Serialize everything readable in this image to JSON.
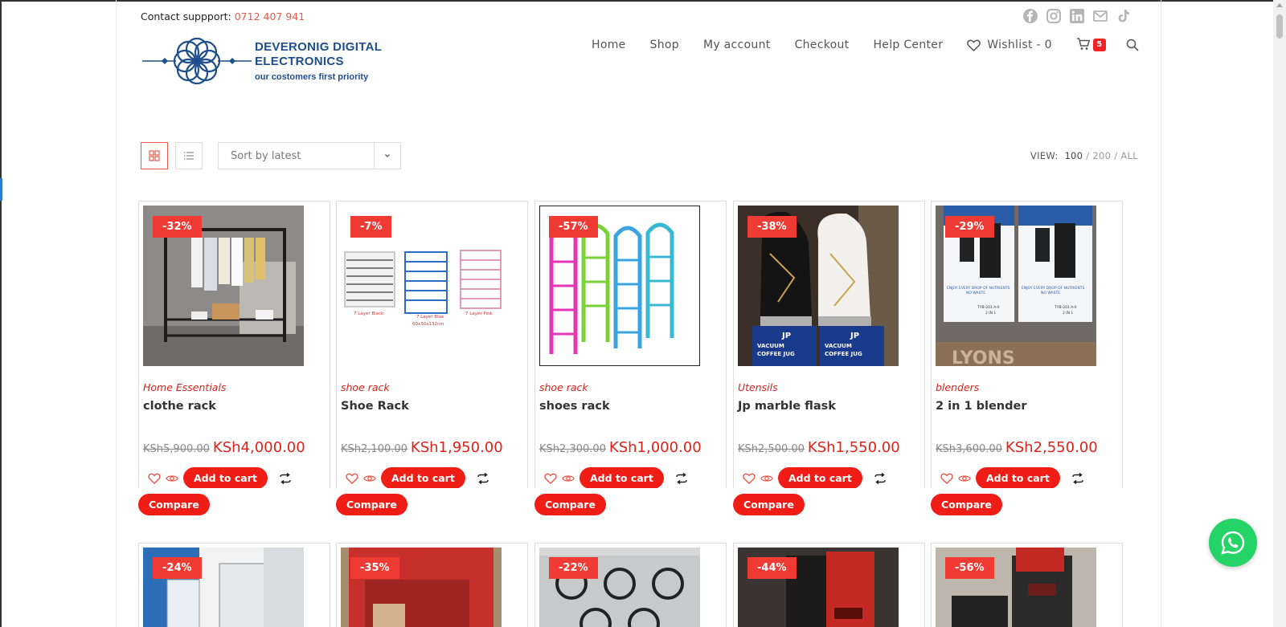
{
  "contact": {
    "label": "Contact suppport: ",
    "phone": "0712 407 941"
  },
  "social_icons": [
    "facebook-icon",
    "instagram-icon",
    "linkedin-icon",
    "email-icon",
    "tiktok-icon"
  ],
  "logo": {
    "line1": "DEVERONIG DIGITAL",
    "line2": "ELECTRONICS",
    "tagline": "our costomers first priority"
  },
  "nav": {
    "items": [
      "Home",
      "Shop",
      "My account",
      "Checkout",
      "Help Center"
    ],
    "wishlist": "Wishlist - 0",
    "cart_count": "5"
  },
  "toolbar": {
    "sort_label": "Sort by latest",
    "view_label": "VIEW:",
    "view_options": [
      "100",
      "200",
      "ALL"
    ],
    "view_sep": "/"
  },
  "products": [
    {
      "discount": "-32%",
      "category": "Home Essentials",
      "name": "clothe rack",
      "old_price": "KSh5,900.00",
      "price": "KSh4,000.00"
    },
    {
      "discount": "-7%",
      "category": "shoe rack",
      "name": "Shoe Rack",
      "old_price": "KSh2,100.00",
      "price": "KSh1,950.00"
    },
    {
      "discount": "-57%",
      "category": "shoe rack",
      "name": "shoes rack",
      "old_price": "KSh2,300.00",
      "price": "KSh1,000.00"
    },
    {
      "discount": "-38%",
      "category": "Utensils",
      "name": "Jp marble flask",
      "old_price": "KSh2,500.00",
      "price": "KSh1,550.00"
    },
    {
      "discount": "-29%",
      "category": "blenders",
      "name": "2 in 1 blender",
      "old_price": "KSh3,600.00",
      "price": "KSh2,550.00"
    }
  ],
  "products_row2": [
    {
      "discount": "-24%"
    },
    {
      "discount": "-35%"
    },
    {
      "discount": "-22%"
    },
    {
      "discount": "-44%"
    },
    {
      "discount": "-56%"
    }
  ],
  "buttons": {
    "add_to_cart": "Add to cart",
    "compare": "Compare"
  },
  "image_text": {
    "shoe_rack_labels": [
      "7 Layer Black",
      "7 Layer Blue",
      "60x30x132cm",
      "7 Layer Pink"
    ],
    "flask_label": [
      "VACUUM",
      "COFFEE JUG"
    ],
    "flask_brand": "JP",
    "blender_brand": "LYONS",
    "blender_box_text": [
      "ENJOY EVERY DROP OF NUTRIENTS",
      "NO WASTE"
    ],
    "blender_model": [
      "TYB-201-A-II",
      "2 IN 1"
    ]
  },
  "colors": {
    "accent": "#f01d16",
    "brand": "#1f4e8c",
    "whatsapp": "#25d366"
  }
}
